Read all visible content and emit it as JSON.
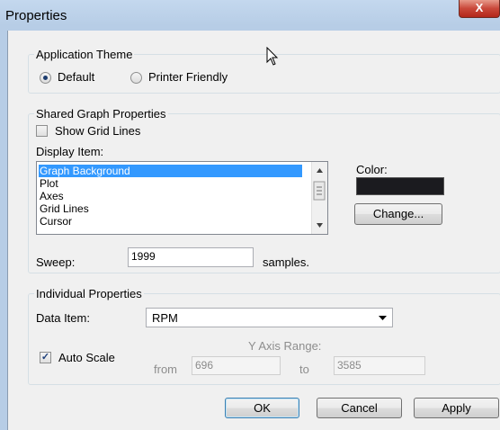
{
  "window": {
    "title": "Properties",
    "close_glyph": "X"
  },
  "theme": {
    "legend": "Application Theme",
    "options": [
      {
        "label": "Default",
        "checked": true
      },
      {
        "label": "Printer Friendly",
        "checked": false
      }
    ]
  },
  "shared": {
    "legend": "Shared Graph Properties",
    "show_grid_lines_label": "Show Grid Lines",
    "show_grid_lines_checked": false,
    "display_item_label": "Display Item:",
    "display_items": [
      "Graph Background",
      "Plot",
      "Axes",
      "Grid Lines",
      "Cursor"
    ],
    "selected_item": "Graph Background",
    "color_label": "Color:",
    "color_value": "#1b1b1f",
    "change_button": "Change...",
    "sweep_label": "Sweep:",
    "sweep_value": "1999",
    "sweep_unit": "samples."
  },
  "individual": {
    "legend": "Individual Properties",
    "data_item_label": "Data Item:",
    "data_item_value": "RPM",
    "auto_scale_label": "Auto Scale",
    "auto_scale_checked": true,
    "y_axis_range_label": "Y Axis Range:",
    "from_label": "from",
    "from_value": "696",
    "to_label": "to",
    "to_value": "3585"
  },
  "buttons": {
    "ok": "OK",
    "cancel": "Cancel",
    "apply": "Apply"
  }
}
